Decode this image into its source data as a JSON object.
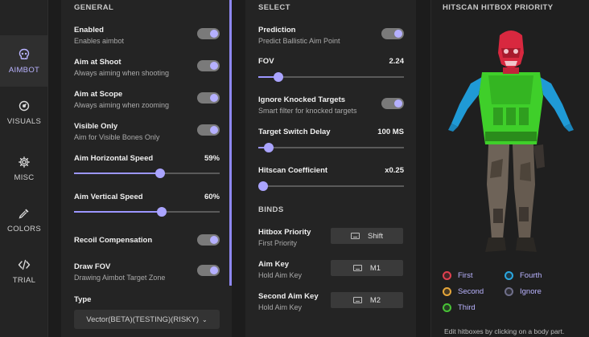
{
  "nav": [
    {
      "label": "AIMBOT",
      "icon": "skull-icon"
    },
    {
      "label": "VISUALS",
      "icon": "eye-icon"
    },
    {
      "label": "MISC",
      "icon": "gear-icon"
    },
    {
      "label": "COLORS",
      "icon": "dropper-icon"
    },
    {
      "label": "TRIAL",
      "icon": "code-icon"
    }
  ],
  "general": {
    "title": "GENERAL",
    "enabled": {
      "title": "Enabled",
      "sub": "Enables aimbot"
    },
    "aim_at_shoot": {
      "title": "Aim at Shoot",
      "sub": "Always aiming when shooting"
    },
    "aim_at_scope": {
      "title": "Aim at Scope",
      "sub": "Always aiming when zooming"
    },
    "visible_only": {
      "title": "Visible Only",
      "sub": "Aim for Visible Bones Only"
    },
    "h_speed": {
      "title": "Aim Horizontal Speed",
      "value": "59%"
    },
    "v_speed": {
      "title": "Aim Vertical Speed",
      "value": "60%"
    },
    "recoil": {
      "title": "Recoil Compensation"
    },
    "draw_fov": {
      "title": "Draw FOV",
      "sub": "Drawing Aimbot Target Zone"
    },
    "type": {
      "title": "Type",
      "value": "Vector(BETA)(TESTING)(RISKY)"
    }
  },
  "select": {
    "title": "SELECT",
    "prediction": {
      "title": "Prediction",
      "sub": "Predict Ballistic Aim Point"
    },
    "fov": {
      "title": "FOV",
      "value": "2.24"
    },
    "knocked": {
      "title": "Ignore Knocked Targets",
      "sub": "Smart filter for knocked targets"
    },
    "switch_delay": {
      "title": "Target Switch Delay",
      "value": "100 MS"
    },
    "hitscan_coef": {
      "title": "Hitscan Coefficient",
      "value": "x0.25"
    }
  },
  "binds": {
    "title": "BINDS",
    "hitbox_priority": {
      "title": "Hitbox Priority",
      "sub": "First Priority",
      "key": "Shift"
    },
    "aim_key": {
      "title": "Aim Key",
      "sub": "Hold Aim Key",
      "key": "M1"
    },
    "second_aim_key": {
      "title": "Second Aim Key",
      "sub": "Hold Aim Key",
      "key": "M2"
    }
  },
  "hitscan": {
    "title": "HITSCAN HITBOX PRIORITY",
    "legend": [
      {
        "label": "First",
        "color": "#e0404f"
      },
      {
        "label": "Fourth",
        "color": "#2aa7e0"
      },
      {
        "label": "Second",
        "color": "#e5a63a"
      },
      {
        "label": "Ignore",
        "color": "#6f6f8a"
      },
      {
        "label": "Third",
        "color": "#48c236"
      }
    ],
    "hint": "Edit hitboxes by clicking on a body part."
  },
  "slider_levels": {
    "h_speed": 0.59,
    "v_speed": 0.6,
    "fov": 0.14,
    "switch_delay": 0.07,
    "hitscan_coef": 0.0
  }
}
